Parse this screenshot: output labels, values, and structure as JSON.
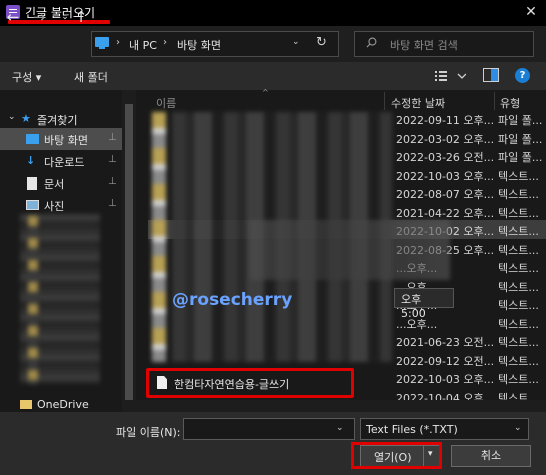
{
  "window": {
    "title": "긴글 불러오기",
    "close": "✕"
  },
  "nav": {
    "back": "←",
    "forward": "→",
    "recent": "⌄",
    "up": "↑",
    "address": [
      "내 PC",
      "바탕 화면"
    ],
    "separator": "›",
    "refresh": "↻",
    "search_placeholder": "바탕 화면 검색"
  },
  "toolbar": {
    "organize": "구성 ▾",
    "new_folder": "새 폴더",
    "help": "?"
  },
  "sidebar": {
    "items": [
      {
        "label": "즐겨찾기",
        "icon": "star-icon",
        "expand": "⌄"
      },
      {
        "label": "바탕 화면",
        "icon": "desktop-icon",
        "pin": "📌"
      },
      {
        "label": "다운로드",
        "icon": "download-icon",
        "pin": "📌"
      },
      {
        "label": "문서",
        "icon": "document-icon",
        "pin": "📌"
      },
      {
        "label": "사진",
        "icon": "pictures-icon",
        "pin": "📌"
      },
      {
        "label": "OneDrive",
        "icon": "folder-icon"
      }
    ]
  },
  "list": {
    "columns": {
      "name": "이름",
      "date": "수정한 날짜",
      "type": "유형"
    },
    "rows": [
      {
        "date": "2022-09-11 오후...",
        "type": "파일 폴..."
      },
      {
        "date": "2022-03-02 오후...",
        "type": "파일 폴..."
      },
      {
        "date": "2022-03-26 오전...",
        "type": "파일 폴..."
      },
      {
        "date": "2022-10-03 오후...",
        "type": "텍스트..."
      },
      {
        "date": "2022-08-07 오후...",
        "type": "텍스트..."
      },
      {
        "date": "2021-04-22 오후...",
        "type": "텍스트..."
      },
      {
        "date": "2022-10-02 오후...",
        "type": "텍스트..."
      },
      {
        "date": "2022-08-25 오후...",
        "type": "텍스트..."
      },
      {
        "date": "...오후...",
        "type": "텍스트..."
      },
      {
        "date": "...오후...",
        "type": "텍스트..."
      },
      {
        "date": "...오후...",
        "type": "텍스트..."
      },
      {
        "date": "...오후...",
        "type": "텍스트..."
      },
      {
        "date": "2021-06-23 오전...",
        "type": "텍스트..."
      },
      {
        "date": "2022-09-12 오전...",
        "type": "텍스트..."
      },
      {
        "date": "2022-10-03 오후...",
        "type": "텍스트..."
      },
      {
        "date": "2022-10-04 오후...",
        "type": "텍스트..."
      }
    ],
    "selected_row": 6,
    "watermark": "@rosecherry",
    "tooltip": "오후 5:00",
    "highlight_file": "한컴타자연연습용-글쓰기"
  },
  "footer": {
    "filename_label": "파일 이름(N):",
    "filename_value": "",
    "filter": "Text Files (*.TXT)",
    "open": "열기(O)",
    "cancel": "취소",
    "dropdown": "⌄"
  },
  "colors": {
    "accent_red": "#e00000",
    "link_blue": "#6aa3ff",
    "help_blue": "#1a7fd4"
  }
}
